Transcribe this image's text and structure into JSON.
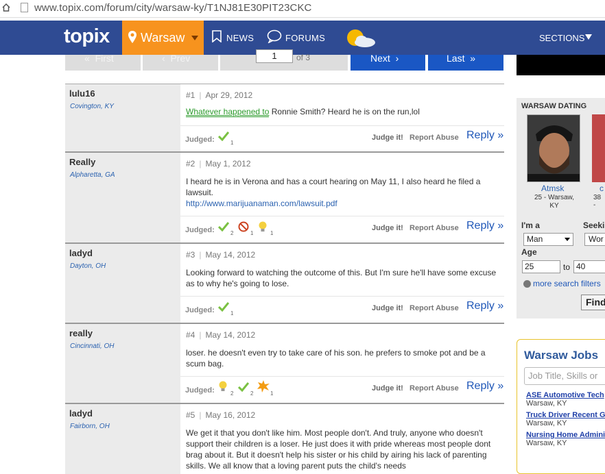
{
  "browser": {
    "url": "www.topix.com/forum/city/warsaw-ky/T1NJ81E30PIT23CKC"
  },
  "nav": {
    "logo": "topix",
    "city": "Warsaw",
    "news": "NEWS",
    "forums": "FORUMS",
    "sections": "SECTIONS"
  },
  "pager": {
    "first": "First",
    "prev": "Prev",
    "current": "1",
    "of": "of 3",
    "next": "Next",
    "last": "Last"
  },
  "post_footer": {
    "judged": "Judged:",
    "judge_it": "Judge it!",
    "report": "Report Abuse",
    "reply": "Reply »"
  },
  "posts": [
    {
      "user": "lulu16",
      "location": "Covington, KY",
      "num": "#1",
      "date": "Apr 29, 2012",
      "link": "Whatever happened to",
      "text": " Ronnie Smith? Heard he is on the run,lol",
      "judgments": [
        {
          "icon": "check-icon",
          "count": "1"
        }
      ]
    },
    {
      "user": "Really",
      "location": "Alpharetta, GA",
      "num": "#2",
      "date": "May 1, 2012",
      "text": "I heard he is in Verona and has a court hearing on May 11, I also heard he filed a lawsuit.",
      "url": "http://www.marijuanaman.com/lawsuit.pdf",
      "judgments": [
        {
          "icon": "check-icon",
          "count": "2"
        },
        {
          "icon": "no-icon",
          "count": "1"
        },
        {
          "icon": "lightbulb-icon",
          "count": "1"
        }
      ]
    },
    {
      "user": "ladyd",
      "location": "Dayton, OH",
      "num": "#3",
      "date": "May 14, 2012",
      "text": "Looking forward to watching the outcome of this. But I'm sure he'll have some excuse as to why he's going to lose.",
      "judgments": [
        {
          "icon": "check-icon",
          "count": "1"
        }
      ]
    },
    {
      "user": "really",
      "location": "Cincinnati, OH",
      "num": "#4",
      "date": "May 14, 2012",
      "text": "loser. he doesn't even try to take care of his son. he prefers to smoke pot and be a scum bag.",
      "judgments": [
        {
          "icon": "lightbulb-icon",
          "count": "2"
        },
        {
          "icon": "check-icon",
          "count": "2"
        },
        {
          "icon": "star-burst-icon",
          "count": "1"
        }
      ]
    },
    {
      "user": "ladyd",
      "location": "Fairborn, OH",
      "num": "#5",
      "date": "May 16, 2012",
      "text": "We get it that you don't like him. Most people don't. And truly, anyone who doesn't support their children is a loser. He just does it with pride whereas most people dont brag about it. But it doesn't help his sister or his child by airing his lack of parenting skills. We all know that a loving parent puts the child's needs"
    }
  ],
  "dating": {
    "heading": "WARSAW DATING",
    "profile1_name": "Atmsk",
    "profile1_info": "25 - Warsaw, KY",
    "profile2_name": "c",
    "profile2_info": "38 -",
    "im_a_label": "I'm a",
    "im_a_value": "Man",
    "seeking_label": "Seeki",
    "seeking_value": "Wor",
    "age_label": "Age",
    "age_from": "25",
    "age_to_label": "to",
    "age_to": "40",
    "more_filters": "more search filters",
    "find": "Find"
  },
  "jobs": {
    "title": "Warsaw Jobs",
    "placeholder": "Job Title, Skills or",
    "items": [
      {
        "title": "ASE Automotive Tech",
        "loc": "Warsaw, KY"
      },
      {
        "title": "Truck Driver Recent G",
        "loc": "Warsaw, KY"
      },
      {
        "title": "Nursing Home Admini",
        "loc": "Warsaw, KY"
      }
    ]
  },
  "colors": {
    "nav_bg": "#2f4b93",
    "city_bg": "#f7931e",
    "link": "#1f57b8",
    "check": "#7ac142"
  }
}
